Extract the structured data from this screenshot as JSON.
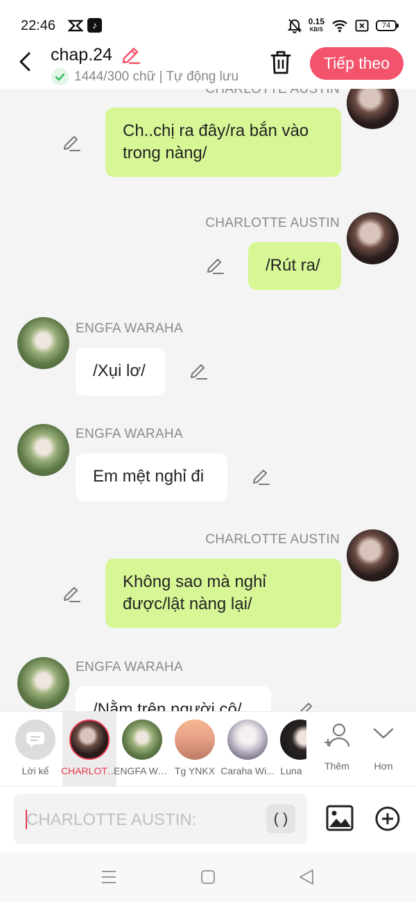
{
  "status_bar": {
    "time": "22:46",
    "net_speed_value": "0.15",
    "net_speed_unit": "KB/S",
    "battery": "74"
  },
  "header": {
    "title": "chap.24",
    "save_status": "1444/300 chữ | Tự động lưu",
    "next_label": "Tiếp theo",
    "accent_color": "#f3546c"
  },
  "messages": [
    {
      "sender": "CHARLOTTE AUSTIN",
      "side": "right",
      "text": "Ch..chị ra đây/ra bắn vào trong nàng/"
    },
    {
      "sender": "CHARLOTTE AUSTIN",
      "side": "right",
      "text": "/Rút ra/"
    },
    {
      "sender": "ENGFA WARAHA",
      "side": "left",
      "text": "/Xụi lơ/"
    },
    {
      "sender": "ENGFA WARAHA",
      "side": "left",
      "text": "Em mệt nghỉ đi"
    },
    {
      "sender": "CHARLOTTE AUSTIN",
      "side": "right",
      "text": "Không sao mà nghỉ được/lật nàng lại/"
    },
    {
      "sender": "ENGFA WARAHA",
      "side": "left",
      "text": "/Nằm trên người cô/"
    }
  ],
  "characters": [
    {
      "name": "Lời kể",
      "selected": false
    },
    {
      "name": "CHARLOTTE AUSTIN",
      "selected": true
    },
    {
      "name": "ENGFA WARAHA",
      "selected": false
    },
    {
      "name": "Tg YNKX",
      "selected": false
    },
    {
      "name": "Caraha Wi...",
      "selected": false
    },
    {
      "name": "Luna",
      "selected": false
    }
  ],
  "tools": {
    "add_label": "Thêm",
    "more_label": "Hơn"
  },
  "input": {
    "placeholder": "CHARLOTTE AUSTIN:",
    "paren_label": "( )"
  },
  "colors": {
    "bubble_right": "#d7f695",
    "bubble_left": "#ffffff",
    "selected": "#e8384f"
  }
}
